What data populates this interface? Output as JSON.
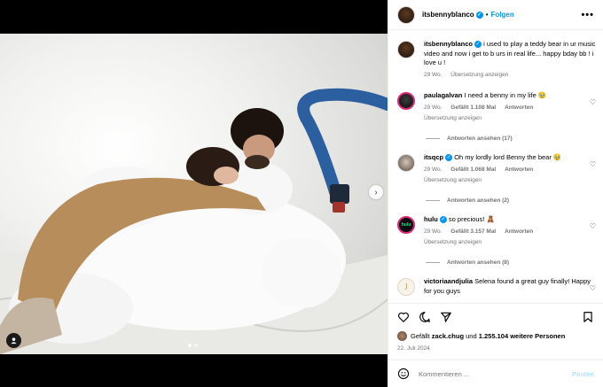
{
  "post": {
    "username": "itsbennyblanco",
    "separator": "•",
    "follow_label": "Folgen",
    "more_label": "•••",
    "caption": "i used to play a teddy bear in ur music video and now i get to b urs in real life... happy bday bb ! i love u !",
    "caption_age": "29 Wo.",
    "caption_translate": "Übersetzung anzeigen"
  },
  "comments": [
    {
      "username": "paulagalvan",
      "text": "I need a benny in my life 🥹",
      "age": "29 Wo.",
      "likes": "Gefällt 1.108 Mal",
      "reply_label": "Antworten",
      "translate": "Übersetzung anzeigen",
      "replies": "Antworten ansehen (17)"
    },
    {
      "username": "itsqcp",
      "text": "Oh my lordly lord Benny the bear 🥹",
      "age": "29 Wo.",
      "likes": "Gefällt 1.068 Mal",
      "reply_label": "Antworten",
      "translate": "Übersetzung anzeigen",
      "replies": "Antworten ansehen (2)"
    },
    {
      "username": "hulu",
      "text": "so precious! 🧸",
      "age": "29 Wo.",
      "likes": "Gefällt 3.157 Mal",
      "reply_label": "Antworten",
      "translate": "Übersetzung anzeigen",
      "replies": "Antworten ansehen (8)"
    },
    {
      "username": "victoriaandjulia",
      "text": "Selena found a great guy finally! Happy for you guys"
    }
  ],
  "avatars": {
    "hulu_logo": "hulu",
    "victoria_logo": "J"
  },
  "engagement": {
    "liked_prefix": "Gefällt",
    "liked_by": "zack.chug",
    "liked_conj": "und",
    "liked_others": "1.255.104 weitere Personen",
    "date": "22. Juli 2024"
  },
  "composer": {
    "placeholder": "Kommentieren ...",
    "post_label": "Posten"
  },
  "colors": {
    "accent": "#0095f6",
    "verified": "#0095f6",
    "muted_text": "#737373",
    "story_ring": "#d62976"
  },
  "icons": [
    "heart-icon",
    "comment-icon",
    "share-icon",
    "save-icon",
    "emoji-icon",
    "tag-user-icon",
    "chevron-right-icon",
    "verified-badge-icon",
    "more-options-icon"
  ]
}
